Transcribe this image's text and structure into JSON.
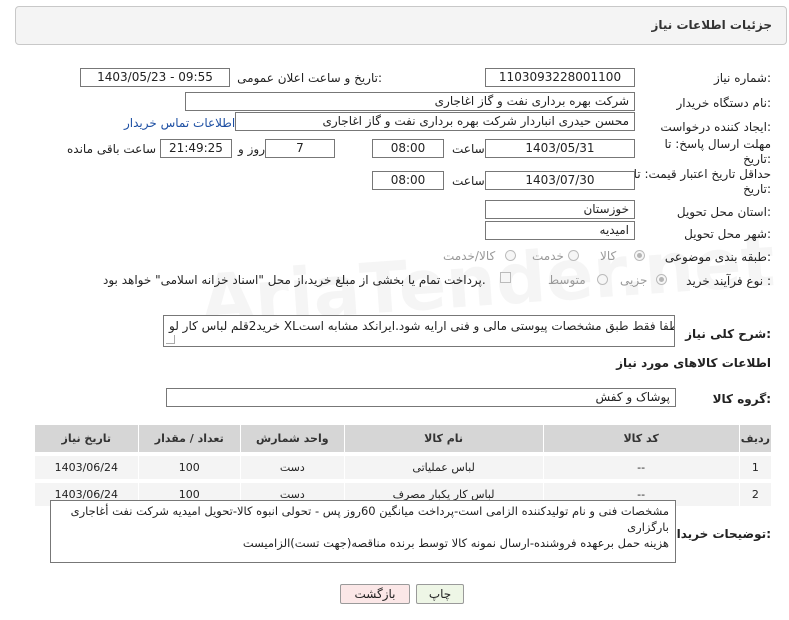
{
  "header": {
    "title": "جزئیات اطلاعات نیاز"
  },
  "form": {
    "need_number": {
      "label": "شماره نیاز:",
      "value": "1103093228001100"
    },
    "announce": {
      "label": "تاریخ و ساعت اعلان عمومی:",
      "value": "1403/05/23 - 09:55"
    },
    "buyer_org": {
      "label": "نام دستگاه خریدار:",
      "value": "شرکت بهره برداری نفت و گاز اغاجاری"
    },
    "creator": {
      "label": "ایجاد کننده درخواست:",
      "value": "محسن حیدری انباردار شرکت بهره برداری نفت و گاز اغاجاری",
      "contact_link": "اطلاعات تماس خریدار"
    },
    "reply_deadline": {
      "label": "مهلت ارسال پاسخ: تا تاریخ:",
      "date": "1403/05/31",
      "time_label": "ساعت",
      "time": "08:00",
      "days": "7",
      "days_label": "روز و",
      "remaining": "21:49:25",
      "remaining_label": "ساعت باقی مانده"
    },
    "price_validity": {
      "label": "حداقل تاریخ اعتبار قیمت: تا تاریخ:",
      "date": "1403/07/30",
      "time_label": "ساعت",
      "time": "08:00"
    },
    "province": {
      "label": "استان محل تحویل:",
      "value": "خوزستان"
    },
    "city": {
      "label": "شهر محل تحویل:",
      "value": "امیدیه"
    },
    "category": {
      "label": "طبقه بندی موضوعی:",
      "options": [
        "کالا",
        "خدمت",
        "کالا/خدمت"
      ],
      "selected": "کالا"
    },
    "process": {
      "label": "نوع فرآیند خرید :",
      "options": [
        "جزیی",
        "متوسط"
      ],
      "selected": "جزیی",
      "payment_note": "پرداخت تمام یا بخشی از مبلغ خرید،از محل \"اسناد خزانه اسلامی\" خواهد بود."
    },
    "description": {
      "label": "شرح کلی نیاز:",
      "value": "خرید2قلم لباس کار لو XLلطفا فقط طبق مشخصات پیوستی مالی و فنی ارایه شود.ایرانکد مشابه است."
    }
  },
  "goods": {
    "section_title": "اطلاعات کالاهای مورد نیاز",
    "group_label": "گروه کالا:",
    "group_value": "پوشاک و کفش",
    "columns": [
      "ردیف",
      "کد کالا",
      "نام کالا",
      "واحد شمارش",
      "تعداد / مقدار",
      "تاریخ نیاز"
    ],
    "rows": [
      {
        "idx": "1",
        "code": "--",
        "name": "لباس عملیاتی",
        "unit": "دست",
        "qty": "100",
        "date": "1403/06/24"
      },
      {
        "idx": "2",
        "code": "--",
        "name": "لباس کار یکبار مصرف",
        "unit": "دست",
        "qty": "100",
        "date": "1403/06/24"
      }
    ]
  },
  "buyer_notes": {
    "label": "توضیحات خریدار:",
    "line1": "مشخصات فنی و نام تولیدکننده الزامی است-پرداخت میانگین 60روز پس - تحولی انبوه کالا-تحویل امیدیه شرکت نفت أغاجاری بارگزاری",
    "line2": "هزینه حمل برعهده فروشنده-ارسال نمونه کالا توسط برنده مناقصه(جهت تست)الزامیست"
  },
  "buttons": {
    "print": "چاپ",
    "back": "بازگشت"
  },
  "watermark": "AriaTender.net"
}
